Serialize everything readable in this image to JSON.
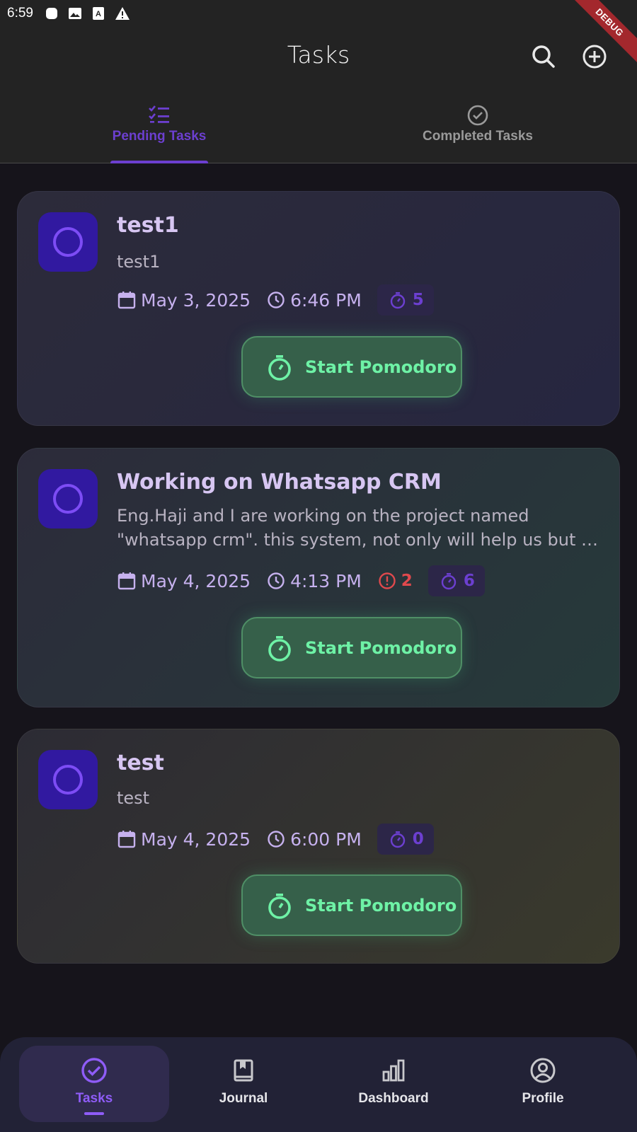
{
  "status_bar": {
    "time": "6:59",
    "debug_label": "DEBUG"
  },
  "app_bar": {
    "title": "Tasks",
    "search_icon": "search-icon",
    "add_icon": "add-circle-icon"
  },
  "tabs": [
    {
      "label": "Pending Tasks",
      "icon": "checklist-icon",
      "active": true
    },
    {
      "label": "Completed Tasks",
      "icon": "check-circle-icon",
      "active": false
    }
  ],
  "tasks": [
    {
      "title": "test1",
      "description": "test1",
      "date": "May 3, 2025",
      "time": "6:46 PM",
      "overdue_count": null,
      "pomodoro_count": "5",
      "button_label": "Start Pomodoro"
    },
    {
      "title": "Working on Whatsapp CRM",
      "description": "Eng.Haji and I are working on the project named \"whatsapp crm\". this system, not only will help us but …",
      "date": "May 4, 2025",
      "time": "4:13 PM",
      "overdue_count": "2",
      "pomodoro_count": "6",
      "button_label": "Start Pomodoro"
    },
    {
      "title": "test",
      "description": "test",
      "date": "May 4, 2025",
      "time": "6:00 PM",
      "overdue_count": null,
      "pomodoro_count": "0",
      "button_label": "Start Pomodoro"
    }
  ],
  "bottom_nav": [
    {
      "label": "Tasks",
      "icon": "check-circle-icon",
      "active": true
    },
    {
      "label": "Journal",
      "icon": "book-icon",
      "active": false
    },
    {
      "label": "Dashboard",
      "icon": "bar-chart-icon",
      "active": false
    },
    {
      "label": "Profile",
      "icon": "account-circle-icon",
      "active": false
    }
  ],
  "colors": {
    "accent": "#6c3fd0",
    "pomodoro_green": "#6ef2a6",
    "overdue_red": "#e0494d",
    "meta_text": "#c6b1ee"
  }
}
